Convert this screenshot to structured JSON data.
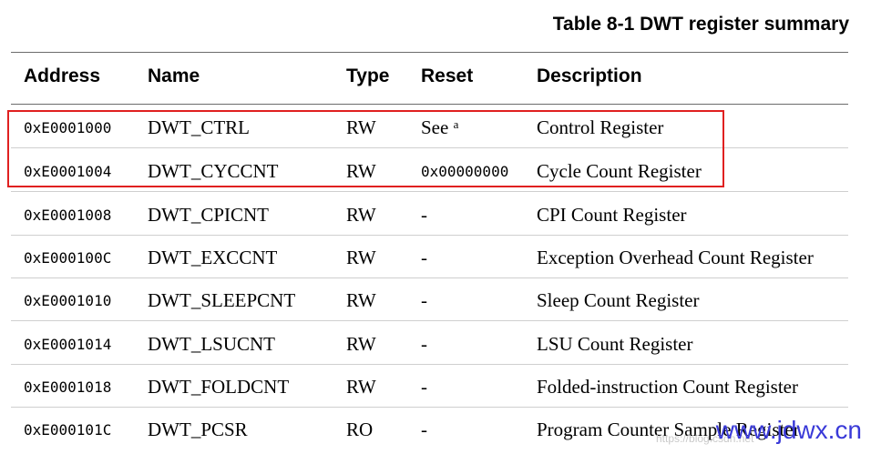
{
  "caption": "Table 8-1 DWT register summary",
  "headers": {
    "address": "Address",
    "name": "Name",
    "type": "Type",
    "reset": "Reset",
    "description": "Description"
  },
  "rows": [
    {
      "address": "0xE0001000",
      "name": "DWT_CTRL",
      "type": "RW",
      "reset": "See",
      "reset_note": "a",
      "description": "Control Register"
    },
    {
      "address": "0xE0001004",
      "name": "DWT_CYCCNT",
      "type": "RW",
      "reset": "0x00000000",
      "description": "Cycle Count Register"
    },
    {
      "address": "0xE0001008",
      "name": "DWT_CPICNT",
      "type": "RW",
      "reset": "-",
      "description": "CPI Count Register"
    },
    {
      "address": "0xE000100C",
      "name": "DWT_EXCCNT",
      "type": "RW",
      "reset": "-",
      "description": "Exception Overhead Count Register"
    },
    {
      "address": "0xE0001010",
      "name": "DWT_SLEEPCNT",
      "type": "RW",
      "reset": "-",
      "description": "Sleep Count Register"
    },
    {
      "address": "0xE0001014",
      "name": "DWT_LSUCNT",
      "type": "RW",
      "reset": "-",
      "description": "LSU Count Register"
    },
    {
      "address": "0xE0001018",
      "name": "DWT_FOLDCNT",
      "type": "RW",
      "reset": "-",
      "description": "Folded-instruction Count Register"
    },
    {
      "address": "0xE000101C",
      "name": "DWT_PCSR",
      "type": "RO",
      "reset": "-",
      "description": "Program Counter Sample Register"
    }
  ],
  "watermark": "www.jdwx.cn",
  "watermark_faint": "https://blog.csdn.net",
  "colors": {
    "highlight_border": "#e02020",
    "watermark": "#3a3ad8"
  }
}
